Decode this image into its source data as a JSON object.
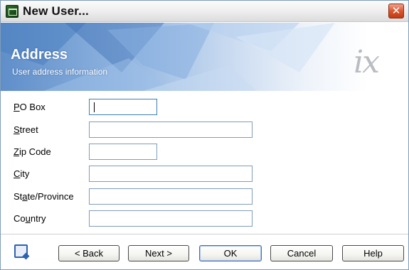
{
  "window": {
    "title": "New User...",
    "close_label": "✕"
  },
  "banner": {
    "title": "Address",
    "subtitle": "User address information",
    "logo_text": "ix"
  },
  "form": {
    "fields": [
      {
        "label_pre": "",
        "label_accel": "P",
        "label_post": "O Box",
        "value": ""
      },
      {
        "label_pre": "",
        "label_accel": "S",
        "label_post": "treet",
        "value": ""
      },
      {
        "label_pre": "",
        "label_accel": "Z",
        "label_post": "ip Code",
        "value": ""
      },
      {
        "label_pre": "",
        "label_accel": "C",
        "label_post": "ity",
        "value": ""
      },
      {
        "label_pre": "St",
        "label_accel": "a",
        "label_post": "te/Province",
        "value": ""
      },
      {
        "label_pre": "Co",
        "label_accel": "u",
        "label_post": "ntry",
        "value": ""
      }
    ]
  },
  "footer": {
    "back_label": "< Back",
    "next_label": "Next >",
    "ok_label": "OK",
    "cancel_label": "Cancel",
    "help_label": "Help"
  },
  "colors": {
    "banner_blue": "#5f8ec9",
    "field_border": "#7f9db9",
    "close_red": "#d9562e"
  }
}
